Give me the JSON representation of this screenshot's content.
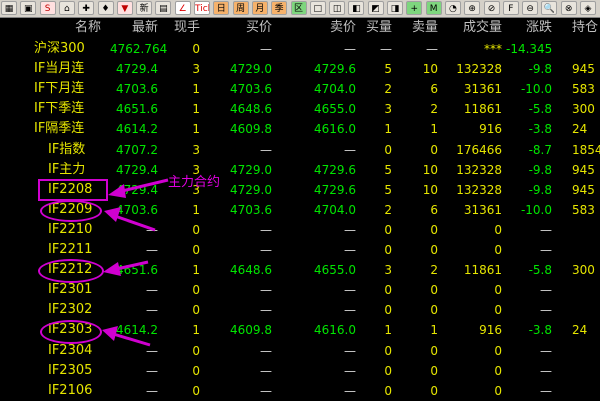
{
  "toolbar": {
    "buttons": [
      "▦",
      "▣",
      "S",
      "⌂",
      "✚",
      "♦",
      "▼",
      "新",
      "▤",
      "∠",
      "Tick",
      "日",
      "周",
      "月",
      "季",
      "区",
      "□",
      "◫",
      "◧",
      "◩",
      "◨",
      "+",
      "M",
      "◔",
      "⊕",
      "⊘",
      "F",
      "⊖",
      "🔍",
      "⊗",
      "◈"
    ]
  },
  "header": {
    "name": "名称",
    "latest": "最新",
    "hand": "现手",
    "bid": "买价",
    "ask": "卖价",
    "bidvol": "买量",
    "askvol": "卖量",
    "volume": "成交量",
    "change": "涨跌",
    "oi": "持仓"
  },
  "rows": [
    {
      "name": "沪深300",
      "latest": "4762.764",
      "hand": "0",
      "bid": "—",
      "ask": "—",
      "bidvol": "—",
      "askvol": "—",
      "volume": "***",
      "change": "-14.345",
      "oi": ""
    },
    {
      "name": "IF当月连",
      "latest": "4729.4",
      "hand": "3",
      "bid": "4729.0",
      "ask": "4729.6",
      "bidvol": "5",
      "askvol": "10",
      "volume": "132328",
      "change": "-9.8",
      "oi": "945"
    },
    {
      "name": "IF下月连",
      "latest": "4703.6",
      "hand": "1",
      "bid": "4703.6",
      "ask": "4704.0",
      "bidvol": "2",
      "askvol": "6",
      "volume": "31361",
      "change": "-10.0",
      "oi": "583"
    },
    {
      "name": "IF下季连",
      "latest": "4651.6",
      "hand": "1",
      "bid": "4648.6",
      "ask": "4655.0",
      "bidvol": "3",
      "askvol": "2",
      "volume": "11861",
      "change": "-5.8",
      "oi": "300"
    },
    {
      "name": "IF隔季连",
      "latest": "4614.2",
      "hand": "1",
      "bid": "4609.8",
      "ask": "4616.0",
      "bidvol": "1",
      "askvol": "1",
      "volume": "916",
      "change": "-3.8",
      "oi": "24"
    },
    {
      "name": "IF指数",
      "latest": "4707.2",
      "hand": "3",
      "bid": "—",
      "ask": "—",
      "bidvol": "0",
      "askvol": "0",
      "volume": "176466",
      "change": "-8.7",
      "oi": "1854"
    },
    {
      "name": "IF主力",
      "latest": "4729.4",
      "hand": "3",
      "bid": "4729.0",
      "ask": "4729.6",
      "bidvol": "5",
      "askvol": "10",
      "volume": "132328",
      "change": "-9.8",
      "oi": "945"
    },
    {
      "name": "IF2208",
      "latest": "4729.4",
      "hand": "3",
      "bid": "4729.0",
      "ask": "4729.6",
      "bidvol": "5",
      "askvol": "10",
      "volume": "132328",
      "change": "-9.8",
      "oi": "945"
    },
    {
      "name": "IF2209",
      "latest": "4703.6",
      "hand": "1",
      "bid": "4703.6",
      "ask": "4704.0",
      "bidvol": "2",
      "askvol": "6",
      "volume": "31361",
      "change": "-10.0",
      "oi": "583"
    },
    {
      "name": "IF2210",
      "latest": "—",
      "hand": "0",
      "bid": "—",
      "ask": "—",
      "bidvol": "0",
      "askvol": "0",
      "volume": "0",
      "change": "—",
      "oi": ""
    },
    {
      "name": "IF2211",
      "latest": "—",
      "hand": "0",
      "bid": "—",
      "ask": "—",
      "bidvol": "0",
      "askvol": "0",
      "volume": "0",
      "change": "—",
      "oi": ""
    },
    {
      "name": "IF2212",
      "latest": "4651.6",
      "hand": "1",
      "bid": "4648.6",
      "ask": "4655.0",
      "bidvol": "3",
      "askvol": "2",
      "volume": "11861",
      "change": "-5.8",
      "oi": "300"
    },
    {
      "name": "IF2301",
      "latest": "—",
      "hand": "0",
      "bid": "—",
      "ask": "—",
      "bidvol": "0",
      "askvol": "0",
      "volume": "0",
      "change": "—",
      "oi": ""
    },
    {
      "name": "IF2302",
      "latest": "—",
      "hand": "0",
      "bid": "—",
      "ask": "—",
      "bidvol": "0",
      "askvol": "0",
      "volume": "0",
      "change": "—",
      "oi": ""
    },
    {
      "name": "IF2303",
      "latest": "4614.2",
      "hand": "1",
      "bid": "4609.8",
      "ask": "4616.0",
      "bidvol": "1",
      "askvol": "1",
      "volume": "916",
      "change": "-3.8",
      "oi": "24"
    },
    {
      "name": "IF2304",
      "latest": "—",
      "hand": "0",
      "bid": "—",
      "ask": "—",
      "bidvol": "0",
      "askvol": "0",
      "volume": "0",
      "change": "—",
      "oi": ""
    },
    {
      "name": "IF2305",
      "latest": "—",
      "hand": "0",
      "bid": "—",
      "ask": "—",
      "bidvol": "0",
      "askvol": "0",
      "volume": "0",
      "change": "—",
      "oi": ""
    },
    {
      "name": "IF2106",
      "latest": "—",
      "hand": "0",
      "bid": "—",
      "ask": "—",
      "bidvol": "0",
      "askvol": "0",
      "volume": "0",
      "change": "—",
      "oi": ""
    }
  ],
  "annotation": {
    "label": "主力合约",
    "color": "#d000d0"
  },
  "colors": {
    "background": "#000000",
    "name": "#e6e600",
    "price": "#00e600",
    "neutral": "#d8d8d8",
    "volume": "#00d0d0"
  }
}
